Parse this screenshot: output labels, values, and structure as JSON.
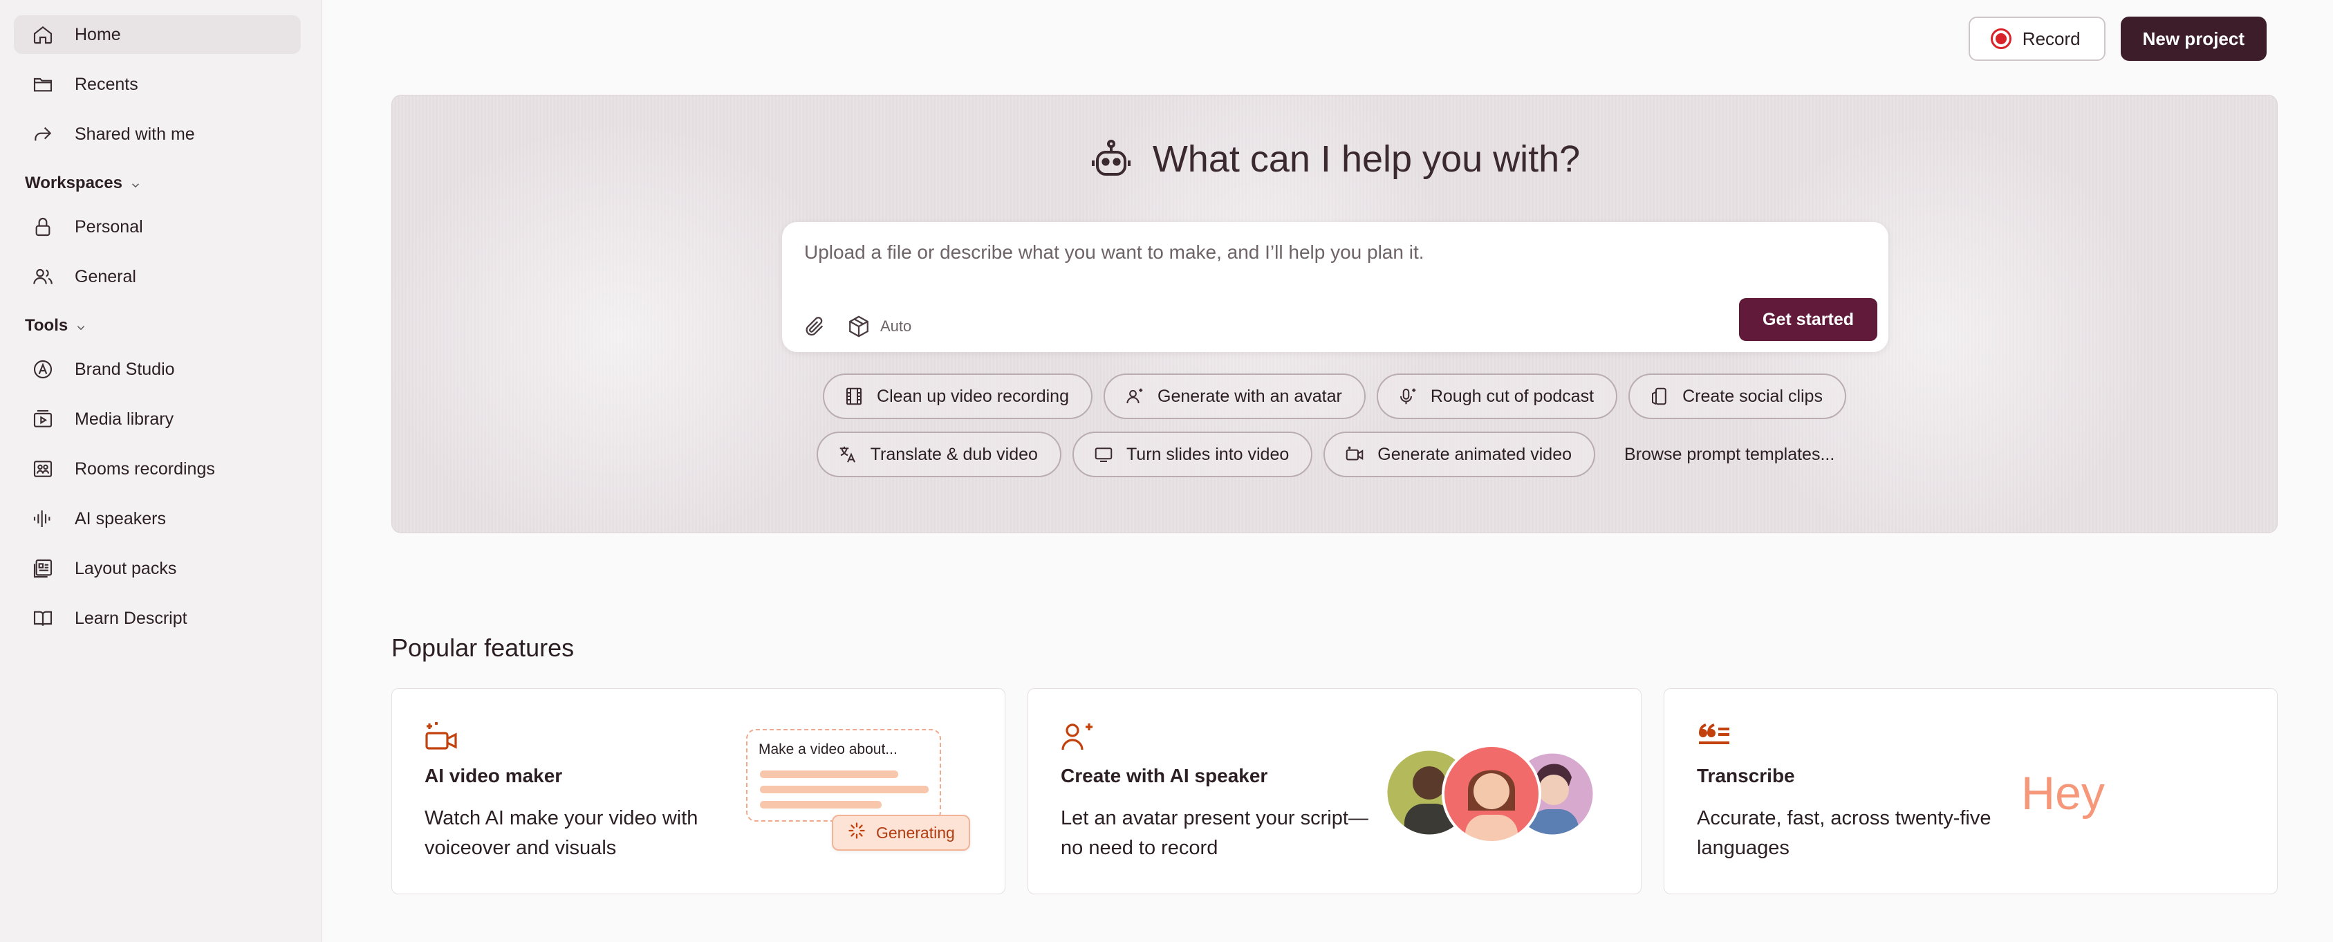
{
  "sidebar": {
    "nav": [
      {
        "label": "Home",
        "icon": "home-icon",
        "active": true
      },
      {
        "label": "Recents",
        "icon": "folder-icon"
      },
      {
        "label": "Shared with me",
        "icon": "share-arrow-icon"
      }
    ],
    "workspaces_label": "Workspaces",
    "workspaces": [
      {
        "label": "Personal",
        "icon": "lock-icon"
      },
      {
        "label": "General",
        "icon": "users-icon"
      }
    ],
    "tools_label": "Tools",
    "tools": [
      {
        "label": "Brand Studio",
        "icon": "brand-icon"
      },
      {
        "label": "Media library",
        "icon": "media-library-icon"
      },
      {
        "label": "Rooms recordings",
        "icon": "rooms-icon"
      },
      {
        "label": "AI speakers",
        "icon": "waveform-icon"
      },
      {
        "label": "Layout packs",
        "icon": "layout-icon"
      },
      {
        "label": "Learn Descript",
        "icon": "book-icon"
      }
    ]
  },
  "topbar": {
    "record_label": "Record",
    "new_project_label": "New project"
  },
  "hero": {
    "title": "What can I help you with?",
    "prompt_placeholder": "Upload a file or describe what you want to make, and I’ll help you plan it.",
    "model_label": "Auto",
    "get_started_label": "Get started",
    "chips_row1": [
      {
        "label": "Clean up video recording",
        "icon": "film-icon"
      },
      {
        "label": "Generate with an avatar",
        "icon": "avatar-sparkle-icon"
      },
      {
        "label": "Rough cut of podcast",
        "icon": "microphone-sparkle-icon"
      },
      {
        "label": "Create social clips",
        "icon": "phone-clips-icon"
      }
    ],
    "chips_row2": [
      {
        "label": "Translate & dub video",
        "icon": "translate-icon"
      },
      {
        "label": "Turn slides into video",
        "icon": "slides-icon"
      },
      {
        "label": "Generate animated video",
        "icon": "animated-video-icon"
      }
    ],
    "browse_label": "Browse prompt templates..."
  },
  "popular": {
    "title": "Popular features",
    "cards": [
      {
        "title": "AI video maker",
        "desc": "Watch AI make your video with voiceover and visuals",
        "mock_text": "Make a video about...",
        "badge": "Generating"
      },
      {
        "title": "Create with AI speaker",
        "desc": "Let an avatar present your script—no need to record"
      },
      {
        "title": "Transcribe",
        "desc": "Accurate, fast, across twenty-five languages",
        "wave_text": "Hey"
      }
    ]
  },
  "colors": {
    "accent": "#611a3a",
    "new_project": "#3d1d2a",
    "record_red": "#d8232a",
    "feature_orange": "#c2410c"
  }
}
